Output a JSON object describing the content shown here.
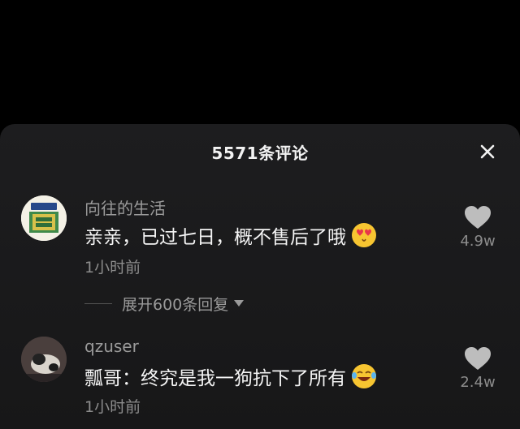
{
  "header": {
    "title": "5571条评论",
    "close_icon": "close-icon"
  },
  "comments": [
    {
      "username": "向往的生活",
      "text": "亲亲，已过七日，概不售后了哦",
      "emoji": "heart-eyes-emoji",
      "time": "1小时前",
      "likes": "4.9w",
      "avatar_text": "向往的生活",
      "avatar_banner": "知心客厅"
    },
    {
      "username": "qzuser",
      "text": "瓢哥：终究是我一狗抗下了所有",
      "emoji": "laughing-tears-emoji",
      "time": "1小时前",
      "likes": "2.4w"
    }
  ],
  "replies": {
    "expand_label": "展开600条回复",
    "chevron_icon": "chevron-down-icon"
  },
  "colors": {
    "background": "#000000",
    "sheet": "#1d1d1f",
    "secondary_text": "#9a9a9a",
    "like_icon": "#bdbdbd",
    "emoji": "#f7c531"
  }
}
